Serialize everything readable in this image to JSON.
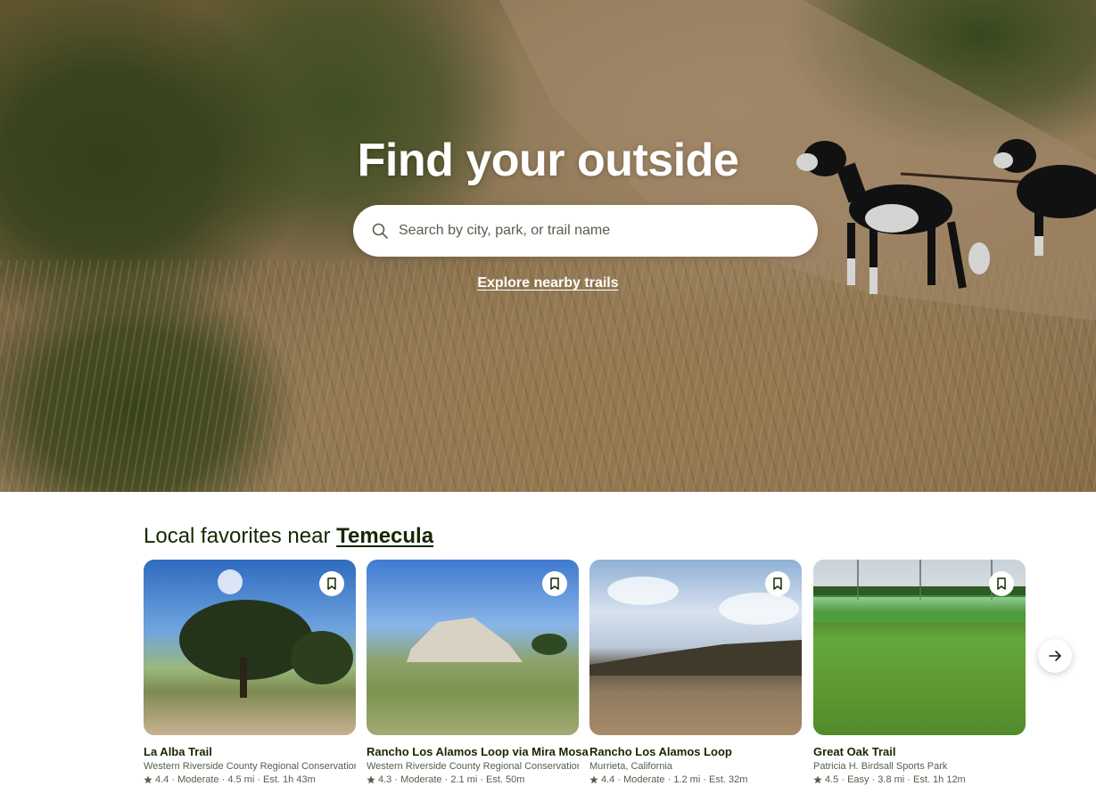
{
  "hero": {
    "title": "Find your outside",
    "search_placeholder": "Search by city, park, or trail name",
    "explore_link": "Explore nearby trails"
  },
  "section": {
    "title_prefix": "Local favorites near",
    "location": "Temecula"
  },
  "trails": [
    {
      "name": "La Alba Trail",
      "park": "Western Riverside County Regional Conservation",
      "meta": "4.4 · Moderate · 4.5 mi · Est. 1h 43m"
    },
    {
      "name": "Rancho Los Alamos Loop via Mira Mosa",
      "park": "Western Riverside County Regional Conservation",
      "meta": "4.3 · Moderate · 2.1 mi · Est. 50m"
    },
    {
      "name": "Rancho Los Alamos Loop",
      "park": "Murrieta, California",
      "meta": "4.4 · Moderate · 1.2 mi · Est. 32m"
    },
    {
      "name": "Great Oak Trail",
      "park": "Patricia H. Birdsall Sports Park",
      "meta": "4.5 · Easy · 3.8 mi · Est. 1h 12m"
    }
  ],
  "icons": {
    "search": "search-icon",
    "bookmark": "bookmark-icon",
    "star": "star-icon",
    "next": "arrow-right-icon"
  }
}
